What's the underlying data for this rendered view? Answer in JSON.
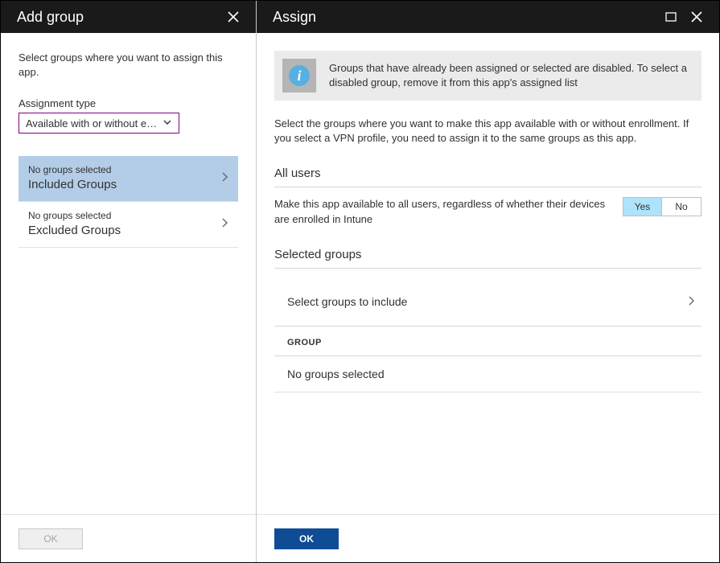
{
  "left": {
    "title": "Add group",
    "description": "Select groups where you want to assign this app.",
    "assignment_type_label": "Assignment type",
    "assignment_type_value": "Available with or without enro...",
    "groups": [
      {
        "sub": "No groups selected",
        "main": "Included Groups",
        "selected": true
      },
      {
        "sub": "No groups selected",
        "main": "Excluded Groups",
        "selected": false
      }
    ],
    "ok": "OK"
  },
  "right": {
    "title": "Assign",
    "banner": "Groups that have already been assigned or selected are disabled. To select a disabled group, remove it from this app's assigned list",
    "description": "Select the groups where you want to make this app available with or without enrollment. If you select a VPN profile, you need to assign it to the same groups as this app.",
    "all_users_heading": "All users",
    "all_users_desc": "Make this app available to all users, regardless of whether their devices are enrolled in Intune",
    "toggle_yes": "Yes",
    "toggle_no": "No",
    "selected_groups_heading": "Selected groups",
    "select_groups_row": "Select groups to include",
    "group_col": "GROUP",
    "no_groups": "No groups selected",
    "ok": "OK"
  }
}
